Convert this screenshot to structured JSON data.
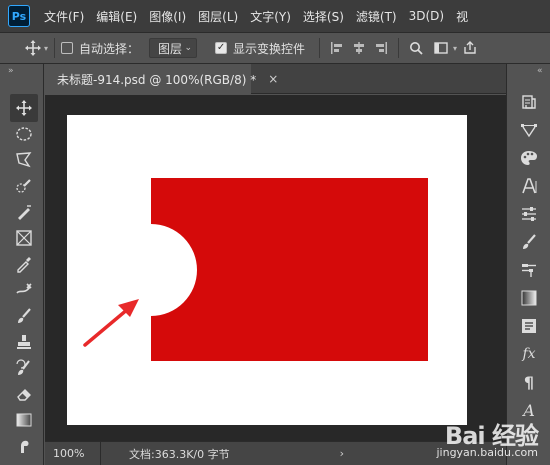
{
  "app": {
    "logo_text": "Ps"
  },
  "menu": {
    "items": [
      "文件(F)",
      "编辑(E)",
      "图像(I)",
      "图层(L)",
      "文字(Y)",
      "选择(S)",
      "滤镜(T)",
      "3D(D)",
      "视"
    ]
  },
  "options": {
    "auto_select_label": "自动选择：",
    "auto_select_checked": false,
    "auto_select_target": "图层",
    "show_transform_label": "显示变换控件",
    "show_transform_checked": true
  },
  "toolbar": {
    "grip": "»",
    "active_tool": "move-tool"
  },
  "right_panel": {
    "grip": "«"
  },
  "document": {
    "tab_title": "未标题-914.psd @ 100%(RGB/8) *",
    "close_glyph": "×"
  },
  "canvas": {
    "rect_color": "#d50a0a",
    "arrow_color": "#e8292a",
    "background": "#ffffff"
  },
  "status": {
    "zoom": "100%",
    "doc_info": "文档:363.3K/0 字节",
    "chevron": "›"
  },
  "watermark": {
    "brand": "Bai 经验",
    "url": "jingyan.baidu.com"
  }
}
